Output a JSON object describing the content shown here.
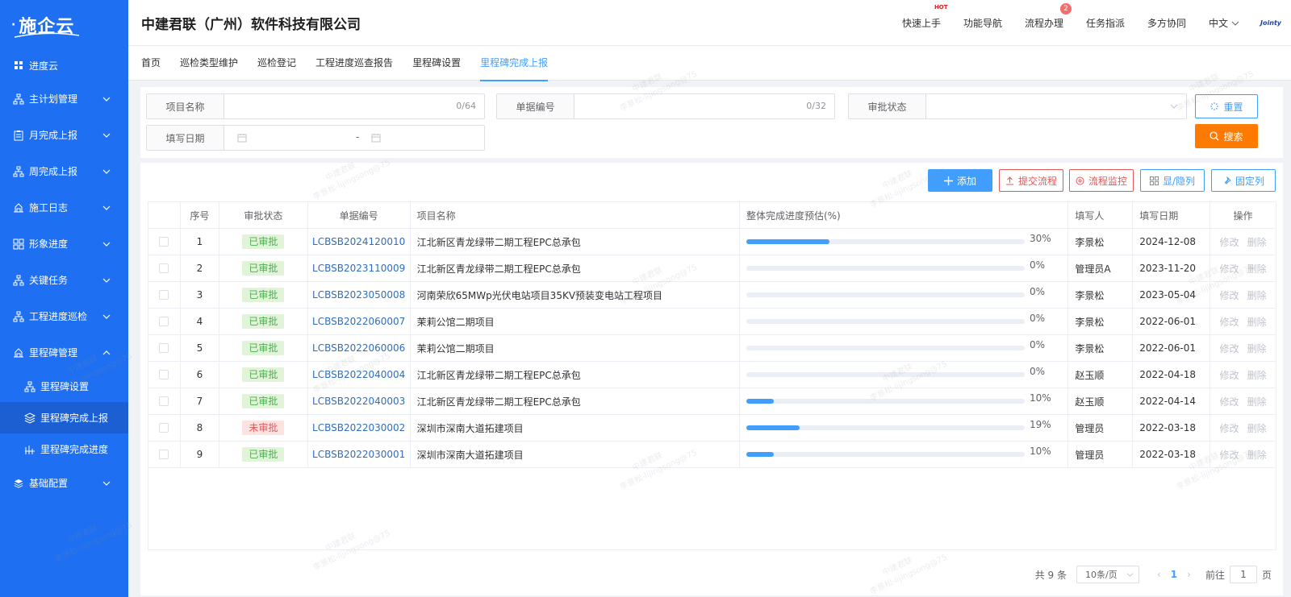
{
  "brand": {
    "name": "施企云"
  },
  "sidebar": {
    "top_item": "进度云",
    "items": [
      {
        "label": "主计划管理",
        "icon": "hierarchy-icon"
      },
      {
        "label": "月完成上报",
        "icon": "clipboard-icon"
      },
      {
        "label": "周完成上报",
        "icon": "hierarchy-icon"
      },
      {
        "label": "施工日志",
        "icon": "construction-icon"
      },
      {
        "label": "形象进度",
        "icon": "grid-icon"
      },
      {
        "label": "关键任务",
        "icon": "hierarchy-icon"
      },
      {
        "label": "工程进度巡检",
        "icon": "hierarchy-icon"
      },
      {
        "label": "里程碑管理",
        "icon": "construction-icon"
      }
    ],
    "sub_items": [
      {
        "label": "里程碑设置",
        "icon": "hierarchy-icon"
      },
      {
        "label": "里程碑完成上报",
        "icon": "layers-icon"
      },
      {
        "label": "里程碑完成进度",
        "icon": "chart-icon"
      }
    ],
    "bottom_item": "基础配置"
  },
  "header": {
    "company": "中建君联（广州）软件科技有限公司",
    "links": [
      "快速上手",
      "功能导航",
      "流程办理",
      "任务指派",
      "多方协同"
    ],
    "hot_badge": "HOT",
    "process_badge": "2",
    "language": "中文",
    "user_logo": "Jointy"
  },
  "tabs": [
    "首页",
    "巡检类型维护",
    "巡检登记",
    "工程进度巡查报告",
    "里程碑设置",
    "里程碑完成上报"
  ],
  "search": {
    "project_name_label": "项目名称",
    "project_name_count": "0/64",
    "doc_no_label": "单据编号",
    "doc_no_count": "0/32",
    "status_label": "审批状态",
    "date_label": "填写日期",
    "date_sep": "-",
    "reset_btn": "重置",
    "search_btn": "搜索"
  },
  "toolbar": {
    "add": "添加",
    "submit": "提交流程",
    "monitor": "流程监控",
    "show_hide": "显/隐列",
    "fix_col": "固定列"
  },
  "table": {
    "headers": [
      "序号",
      "审批状态",
      "单据编号",
      "项目名称",
      "整体完成进度预估(%)",
      "填写人",
      "填写日期",
      "操作"
    ],
    "rows": [
      {
        "no": "1",
        "status": "已审批",
        "approved": true,
        "code": "LCBSB2024120010",
        "name": "江北新区青龙绿带二期工程EPC总承包",
        "progress": 30,
        "progress_text": "30%",
        "user": "李景松",
        "date": "2024-12-08"
      },
      {
        "no": "2",
        "status": "已审批",
        "approved": true,
        "code": "LCBSB2023110009",
        "name": "江北新区青龙绿带二期工程EPC总承包",
        "progress": 0,
        "progress_text": "0%",
        "user": "管理员A",
        "date": "2023-11-20"
      },
      {
        "no": "3",
        "status": "已审批",
        "approved": true,
        "code": "LCBSB2023050008",
        "name": "河南荣欣65MWp光伏电站项目35KV预装变电站工程项目",
        "progress": 0,
        "progress_text": "0%",
        "user": "李景松",
        "date": "2023-05-04"
      },
      {
        "no": "4",
        "status": "已审批",
        "approved": true,
        "code": "LCBSB2022060007",
        "name": "茉莉公馆二期项目",
        "progress": 0,
        "progress_text": "0%",
        "user": "李景松",
        "date": "2022-06-01"
      },
      {
        "no": "5",
        "status": "已审批",
        "approved": true,
        "code": "LCBSB2022060006",
        "name": "茉莉公馆二期项目",
        "progress": 0,
        "progress_text": "0%",
        "user": "李景松",
        "date": "2022-06-01"
      },
      {
        "no": "6",
        "status": "已审批",
        "approved": true,
        "code": "LCBSB2022040004",
        "name": "江北新区青龙绿带二期工程EPC总承包",
        "progress": 0,
        "progress_text": "0%",
        "user": "赵玉顺",
        "date": "2022-04-18"
      },
      {
        "no": "7",
        "status": "已审批",
        "approved": true,
        "code": "LCBSB2022040003",
        "name": "江北新区青龙绿带二期工程EPC总承包",
        "progress": 10,
        "progress_text": "10%",
        "user": "赵玉顺",
        "date": "2022-04-14"
      },
      {
        "no": "8",
        "status": "未审批",
        "approved": false,
        "code": "LCBSB2022030002",
        "name": "深圳市深南大道拓建项目",
        "progress": 19,
        "progress_text": "19%",
        "user": "管理员",
        "date": "2022-03-18"
      },
      {
        "no": "9",
        "status": "已审批",
        "approved": true,
        "code": "LCBSB2022030001",
        "name": "深圳市深南大道拓建项目",
        "progress": 10,
        "progress_text": "10%",
        "user": "管理员",
        "date": "2022-03-18"
      }
    ],
    "op_edit": "修改",
    "op_delete": "删除"
  },
  "pager": {
    "total": "共 9 条",
    "page_size": "10条/页",
    "current": "1",
    "goto_label": "前往",
    "goto_value": "1",
    "page_suffix": "页"
  },
  "watermark": {
    "line1": "中建君联",
    "line2": "李景松-lijingsong@75"
  },
  "colors": {
    "sidebar": "#1e6ff1",
    "primary": "#409eff",
    "search": "#ff7a00",
    "danger": "#e45757"
  }
}
